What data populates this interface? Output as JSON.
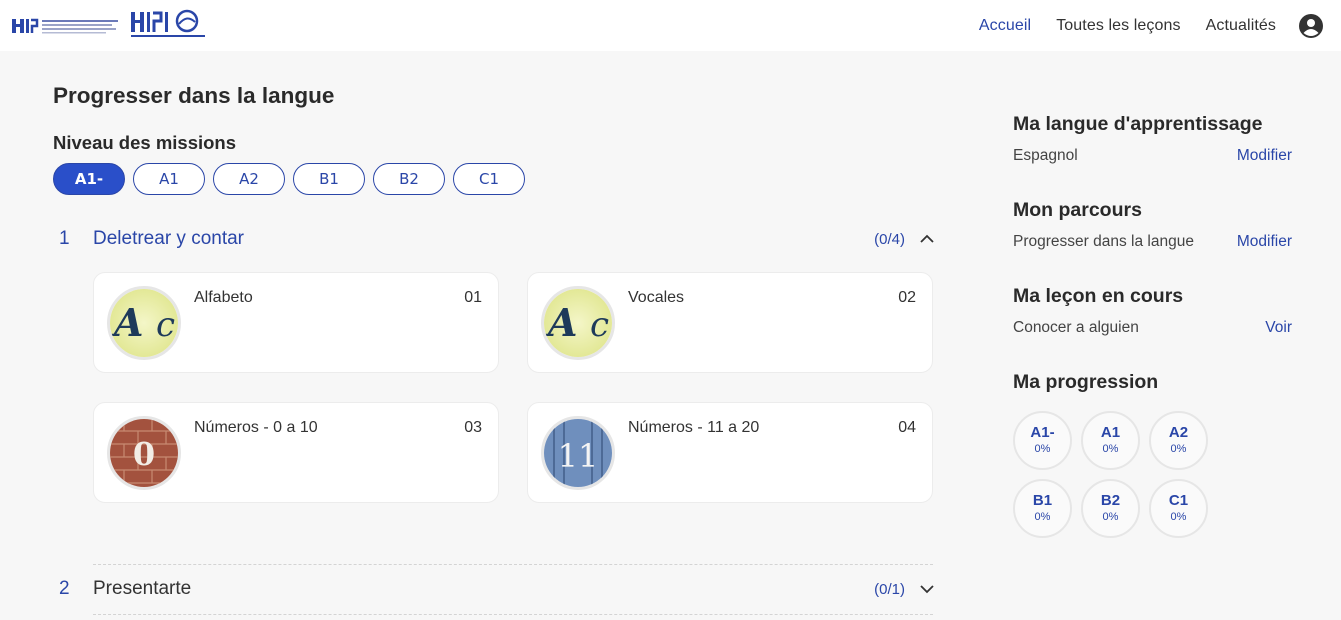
{
  "nav": {
    "items": [
      {
        "label": "Accueil",
        "active": true
      },
      {
        "label": "Toutes les leçons",
        "active": false
      },
      {
        "label": "Actualités",
        "active": false
      }
    ],
    "user_icon": "user-icon"
  },
  "main": {
    "title": "Progresser dans la langue",
    "levels_title": "Niveau des missions",
    "levels": [
      {
        "label": "A1-",
        "active": true
      },
      {
        "label": "A1",
        "active": false
      },
      {
        "label": "A2",
        "active": false
      },
      {
        "label": "B1",
        "active": false
      },
      {
        "label": "B2",
        "active": false
      },
      {
        "label": "C1",
        "active": false
      }
    ],
    "sections": [
      {
        "number": "1",
        "title": "Deletrear y contar",
        "count": "(0/4)",
        "expanded": true,
        "lessons": [
          {
            "name": "Alfabeto",
            "number": "01",
            "image": "letters-Ac"
          },
          {
            "name": "Vocales",
            "number": "02",
            "image": "letters-Ac"
          },
          {
            "name": "Números - 0 a 10",
            "number": "03",
            "image": "number-0"
          },
          {
            "name": "Números - 11 a 20",
            "number": "04",
            "image": "number-11"
          }
        ]
      },
      {
        "number": "2",
        "title": "Presentarte",
        "count": "(0/1)",
        "expanded": false
      }
    ]
  },
  "sidebar": {
    "language": {
      "title": "Ma langue d'apprentissage",
      "value": "Espagnol",
      "link": "Modifier"
    },
    "path": {
      "title": "Mon parcours",
      "value": "Progresser dans la langue",
      "link": "Modifier"
    },
    "current": {
      "title": "Ma leçon en cours",
      "value": "Conocer a alguien",
      "link": "Voir"
    },
    "progress": {
      "title": "Ma progression",
      "items": [
        {
          "level": "A1-",
          "percent": "0%"
        },
        {
          "level": "A1",
          "percent": "0%"
        },
        {
          "level": "A2",
          "percent": "0%"
        },
        {
          "level": "B1",
          "percent": "0%"
        },
        {
          "level": "B2",
          "percent": "0%"
        },
        {
          "level": "C1",
          "percent": "0%"
        }
      ]
    }
  },
  "colors": {
    "accent": "#2a46a8",
    "active_pill": "#2a4fc9",
    "background": "#f7f7f7"
  }
}
